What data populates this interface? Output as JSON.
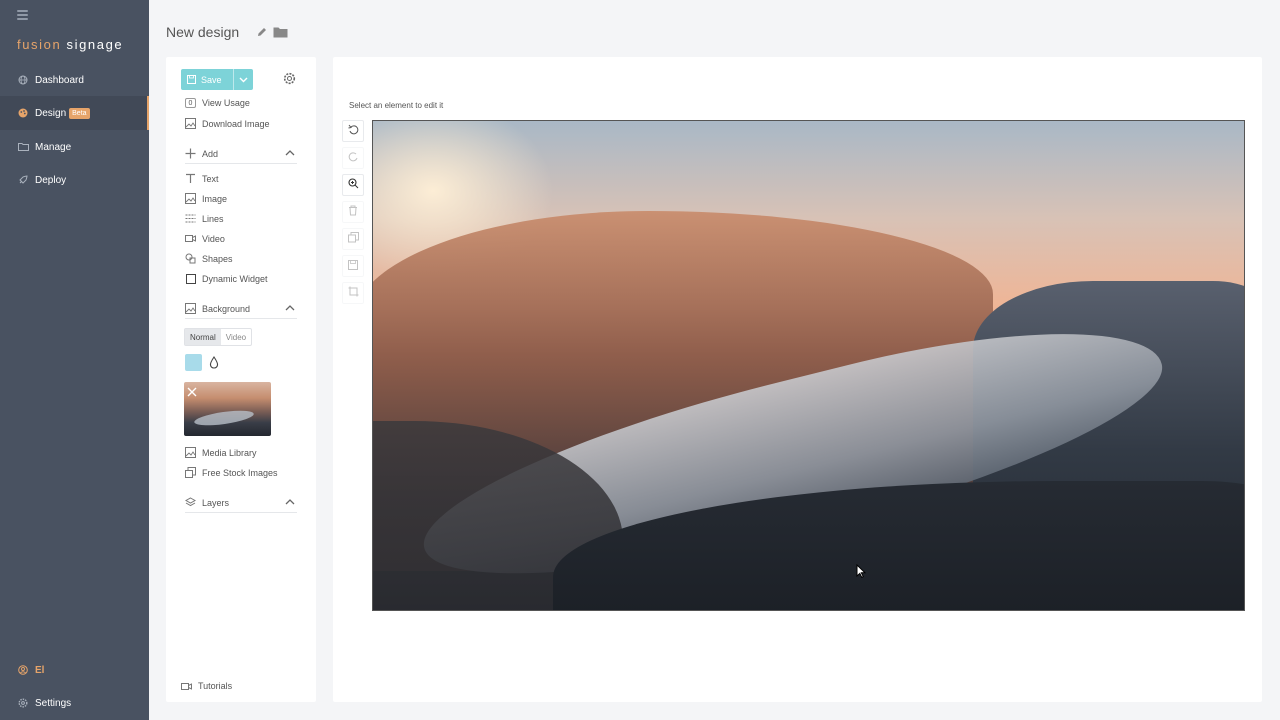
{
  "app": {
    "brand_part1": "fusion",
    "brand_part2": "signage",
    "accent_color": "#e6a46a",
    "sidebar_color": "#495261"
  },
  "nav": {
    "dashboard": "Dashboard",
    "design": "Design",
    "design_badge": "Beta",
    "manage": "Manage",
    "deploy": "Deploy",
    "user": "El",
    "settings": "Settings"
  },
  "header": {
    "title": "New design"
  },
  "panel": {
    "save_label": "Save",
    "view_usage_count": "0",
    "view_usage": "View Usage",
    "download_image": "Download Image",
    "add_section": "Add",
    "add_items": {
      "text": "Text",
      "image": "Image",
      "lines": "Lines",
      "video": "Video",
      "shapes": "Shapes",
      "dynamic_widget": "Dynamic Widget"
    },
    "background_section": "Background",
    "bg_mode_normal": "Normal",
    "bg_mode_video": "Video",
    "bg_color": "#a8dbea",
    "media_library": "Media Library",
    "free_stock_images": "Free Stock Images",
    "layers_section": "Layers",
    "tutorials": "Tutorials"
  },
  "canvas": {
    "hint": "Select an element to edit it"
  }
}
